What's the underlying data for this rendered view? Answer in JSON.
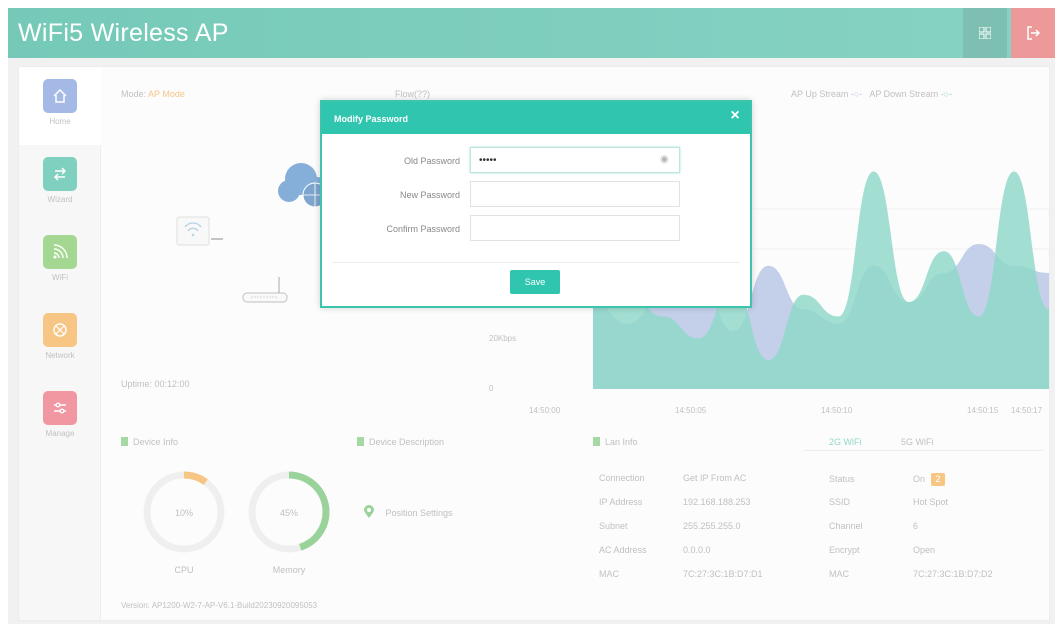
{
  "header": {
    "title": "WiFi5 Wireless AP",
    "grid_icon": "grid-icon",
    "logout_icon": "logout-icon"
  },
  "sidebar": {
    "items": [
      {
        "label": "Home",
        "icon": "home-icon",
        "color": "#6d8ed6"
      },
      {
        "label": "Wizard",
        "icon": "wizard-icon",
        "color": "#32b39a"
      },
      {
        "label": "WiFi",
        "icon": "wifi-icon",
        "color": "#6cbf4f"
      },
      {
        "label": "Network",
        "icon": "network-icon",
        "color": "#f2a43a"
      },
      {
        "label": "Manage",
        "icon": "manage-icon",
        "color": "#e8576a"
      }
    ]
  },
  "status": {
    "mode_label": "Mode:",
    "mode_value": "AP Mode",
    "sink_label": "Flow(??)",
    "uptime_label": "Uptime:",
    "uptime_value": "00:12:00"
  },
  "chart_data": {
    "type": "area",
    "legend": [
      "AP Up Stream",
      "AP Down Stream"
    ],
    "yticks": [
      "20Kbps",
      "0"
    ],
    "x": [
      "14:50:00",
      "14:50:05",
      "14:50:10",
      "14:50:15",
      "14:50:17"
    ],
    "series": [
      {
        "name": "AP Up Stream",
        "color": "#8fa7d8",
        "values": [
          12,
          9,
          13,
          16,
          8,
          17,
          11,
          9,
          17,
          12,
          16,
          20,
          17,
          16
        ]
      },
      {
        "name": "AP Down Stream",
        "color": "#4bc0a7",
        "values": [
          15,
          13,
          10,
          7,
          14,
          4,
          13,
          10,
          30,
          12,
          19,
          10,
          30,
          11
        ]
      }
    ],
    "ylim": [
      0,
      32
    ]
  },
  "device_info": {
    "title": "Device Info",
    "cpu_label": "CPU",
    "cpu_value": "10%",
    "cpu_fraction": 0.1,
    "cpu_color": "#f2a43a",
    "mem_label": "Memory",
    "mem_value": "45%",
    "mem_fraction": 0.45,
    "mem_color": "#5cb85c"
  },
  "device_desc": {
    "title": "Device Description",
    "position_label": "Position Settings"
  },
  "lan_info": {
    "title": "Lan Info",
    "rows": [
      {
        "k": "Connection",
        "v": "Get IP From AC"
      },
      {
        "k": "IP Address",
        "v": "192.168.188.253"
      },
      {
        "k": "Subnet",
        "v": "255.255.255.0"
      },
      {
        "k": "AC Address",
        "v": "0.0.0.0"
      },
      {
        "k": "MAC",
        "v": "7C:27:3C:1B:D7:D1"
      }
    ]
  },
  "wifi_info": {
    "tabs": [
      "2G WiFi",
      "5G WiFi"
    ],
    "rows": [
      {
        "k": "Status",
        "v": "On",
        "badge": "2"
      },
      {
        "k": "SSID",
        "v": "Hot Spot"
      },
      {
        "k": "Channel",
        "v": "6"
      },
      {
        "k": "Encrypt",
        "v": "Open"
      },
      {
        "k": "MAC",
        "v": "7C:27:3C:1B:D7:D2"
      }
    ]
  },
  "version": "Version: AP1200-W2-7-AP-V6.1-Build20230920095053",
  "modal": {
    "title": "Modify Password",
    "close": "×",
    "old_label": "Old Password",
    "old_value": "•••••",
    "new_label": "New Password",
    "new_value": "",
    "confirm_label": "Confirm Password",
    "confirm_value": "",
    "save_label": "Save"
  }
}
